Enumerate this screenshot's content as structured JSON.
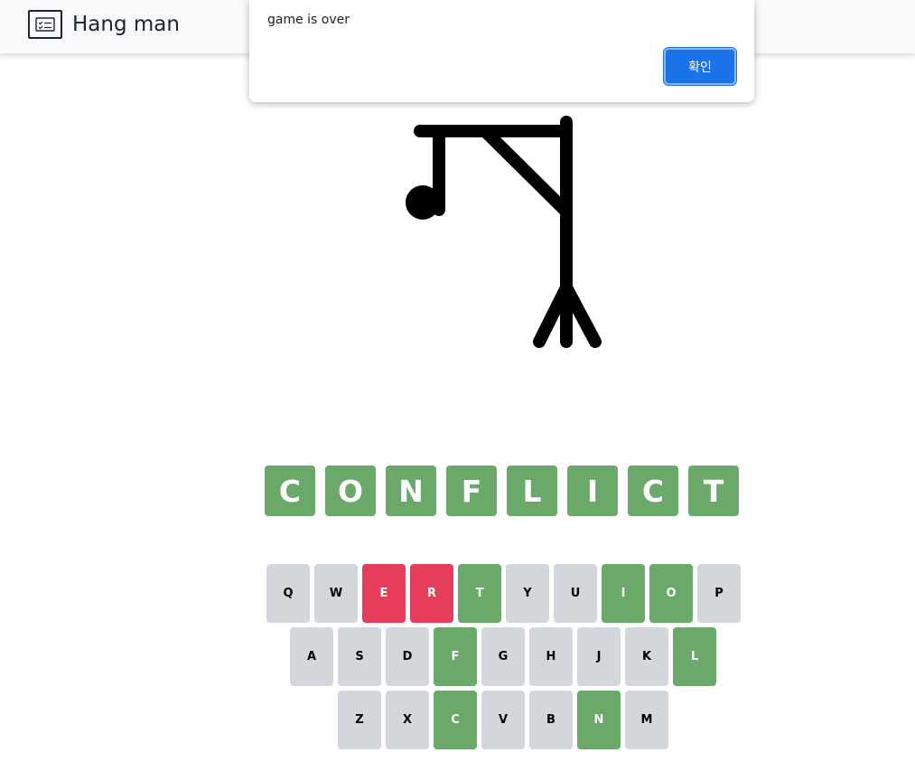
{
  "navbar": {
    "title": "Hang man",
    "icon": "card-checklist-icon"
  },
  "alert": {
    "message": "game is over",
    "ok_label": "확인"
  },
  "colors": {
    "correct": "#6aa96a",
    "wrong": "#e63d5a",
    "unused": "#d3d6da",
    "ok_button": "#1a73e8"
  },
  "word": {
    "letters": [
      "C",
      "O",
      "N",
      "F",
      "L",
      "I",
      "C",
      "T"
    ]
  },
  "keyboard": {
    "rows": [
      [
        {
          "key": "Q",
          "state": "unused"
        },
        {
          "key": "W",
          "state": "unused"
        },
        {
          "key": "E",
          "state": "wrong"
        },
        {
          "key": "R",
          "state": "wrong"
        },
        {
          "key": "T",
          "state": "correct"
        },
        {
          "key": "Y",
          "state": "unused"
        },
        {
          "key": "U",
          "state": "unused"
        },
        {
          "key": "I",
          "state": "correct"
        },
        {
          "key": "O",
          "state": "correct"
        },
        {
          "key": "P",
          "state": "unused"
        }
      ],
      [
        {
          "key": "A",
          "state": "unused"
        },
        {
          "key": "S",
          "state": "unused"
        },
        {
          "key": "D",
          "state": "unused"
        },
        {
          "key": "F",
          "state": "correct"
        },
        {
          "key": "G",
          "state": "unused"
        },
        {
          "key": "H",
          "state": "unused"
        },
        {
          "key": "J",
          "state": "unused"
        },
        {
          "key": "K",
          "state": "unused"
        },
        {
          "key": "L",
          "state": "correct"
        }
      ],
      [
        {
          "key": "Z",
          "state": "unused"
        },
        {
          "key": "X",
          "state": "unused"
        },
        {
          "key": "C",
          "state": "correct"
        },
        {
          "key": "V",
          "state": "unused"
        },
        {
          "key": "B",
          "state": "unused"
        },
        {
          "key": "N",
          "state": "correct"
        },
        {
          "key": "M",
          "state": "unused"
        }
      ]
    ]
  }
}
